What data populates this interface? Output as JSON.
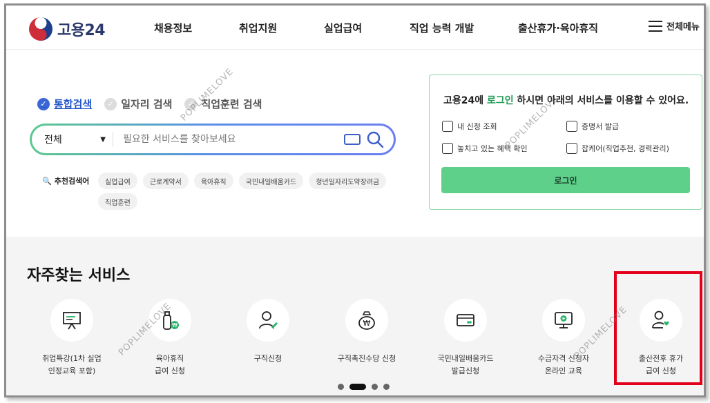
{
  "header": {
    "logo_text": "고용24",
    "nav": [
      "채용정보",
      "취업지원",
      "실업급여",
      "직업 능력 개발",
      "출산휴가·육아휴직"
    ],
    "menu_all": "전체메뉴"
  },
  "search": {
    "tabs": [
      "통합검색",
      "일자리 검색",
      "직업훈련 검색"
    ],
    "active_tab": 0,
    "select_value": "전체",
    "placeholder": "필요한 서비스를 찾아보세요",
    "recommended_label": "추천검색어",
    "chips": [
      "실업급여",
      "근로계약서",
      "육아휴직",
      "국민내일배움카드",
      "청년일자리도약장려금",
      "직업훈련"
    ]
  },
  "login_card": {
    "msg_pre": "고용24에 ",
    "msg_highlight": "로그인",
    "msg_post": " 하시면 아래의 서비스를 이용할 수 있어요.",
    "services": [
      "내 신청 조회",
      "증명서 발급",
      "놓치고 있는 혜택 확인",
      "잡케어(직업추천, 경력관리)"
    ],
    "button": "로그인"
  },
  "frequent": {
    "title": "자주찾는 서비스",
    "items": [
      {
        "label": "취업특강(1차 실업\n인정교육 포함)",
        "icon": "presentation-board-icon"
      },
      {
        "label": "육아휴직\n급여 신청",
        "icon": "baby-bottle-icon"
      },
      {
        "label": "구직신청",
        "icon": "person-pen-icon"
      },
      {
        "label": "구직촉진수당 신청",
        "icon": "money-bag-icon"
      },
      {
        "label": "국민내일배움카드\n발급신청",
        "icon": "card-icon"
      },
      {
        "label": "수급자격 신청자\n온라인 교육",
        "icon": "monitor-play-icon"
      },
      {
        "label": "출산전후 휴가\n급여 신청",
        "icon": "person-heart-icon"
      }
    ],
    "carousel_pages": 4,
    "carousel_active": 1
  },
  "watermark": "POPLIMELOVE",
  "colors": {
    "accent_blue": "#3b66d6",
    "accent_green": "#1f9a53",
    "login_button": "#5ed08a",
    "highlight_red": "#e3001b"
  }
}
